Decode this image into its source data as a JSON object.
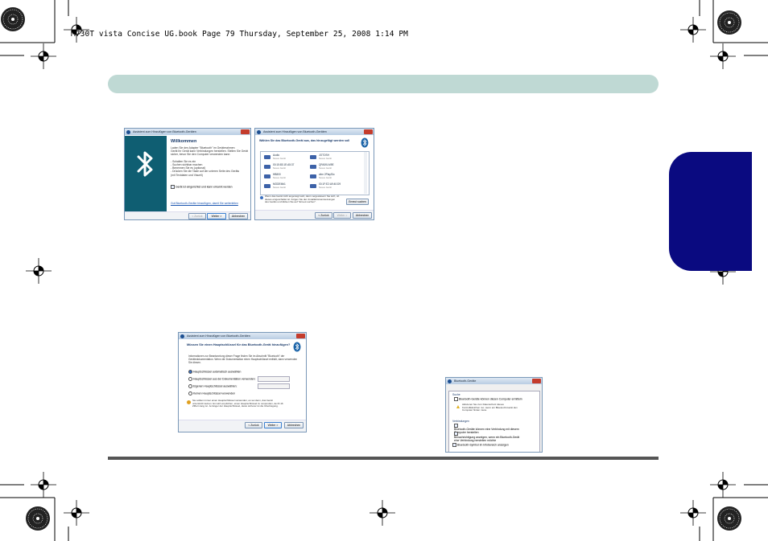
{
  "header": {
    "file_line": "M730T vista Concise UG.book  Page 79  Thursday, September 25, 2008  1:14 PM"
  },
  "dialog_welcome": {
    "title": "Assistent zum Hinzufügen von Bluetooth-Geräten",
    "heading": "Willkommen",
    "body": [
      "Laden Sie den Adapter \"Bluetooth\" im Geräterahmen",
      "Gerät Ihr Gerät kann Verbindungen herstellen. Stellen Sie Gerät",
      "sicher, bevor Sie den Computer verwenden kann:",
      "",
      "- Schalten Sie es ein",
      "- Suchen sichtbar machen",
      "- Benennen Sie es (optional)",
      "- Drücken Sie die Taste auf der unteren Seite des Geräts",
      "  (mit Textdaten und Visuell)"
    ],
    "checkbox_label": "Gerät ist eingerichtet und kann erkannt werden",
    "link": "Gut Bluetooth-Geräte hinzufügen, damit Sie weiterleiten",
    "btn_back": "< Zurück",
    "btn_next": "Weiter >",
    "btn_cancel": "Abbrechen"
  },
  "dialog_select": {
    "title": "Assistent zum Hinzufügen von Bluetooth-Geräten",
    "heading": "Wählen Sie das Bluetooth-Gerät aus, das hinzugefügt werden soll",
    "devices": [
      {
        "name": "Audio",
        "sub": "Neues Gerät"
      },
      {
        "name": "JOTOSH",
        "sub": "Neues Gerät"
      },
      {
        "name": "00:15:83:1E:A5:37",
        "sub": "Neues Gerät"
      },
      {
        "name": "QFA0KLM9E",
        "sub": "Neues Gerät"
      },
      {
        "name": "HB800",
        "sub": "Neues Gerät"
      },
      {
        "name": "citrn 2PlaySlo",
        "sub": "Neues Gerät"
      },
      {
        "name": "MODEM#1",
        "sub": "Neues Gerät"
      },
      {
        "name": "00:1F:E2:A9:40:D9",
        "sub": "Neues Gerät"
      }
    ],
    "footer_text": [
      "Wenn das Gerät nicht angezeigt wird, dann vergewissern Sie sich, ob",
      "dieses eingeschaltet ist. Folgen Sie den Installationsanweisungen",
      "des Geräts und klicken Sie auf \"Erneut suchen\"."
    ],
    "btn_search": "Erneut suchen",
    "btn_back": "< Zurück",
    "btn_next": "Weiter >",
    "btn_cancel": "Abbrechen"
  },
  "dialog_passkey": {
    "title": "Assistent zum Hinzufügen von Bluetooth-Geräten",
    "heading": "Müssen Sie einen Hauptschlüssel für das Bluetooth-Gerät hinzufügen?",
    "intro": [
      "Informationen zur Beantwortung dieser Frage finden Sie im Abschnitt \"Bluetooth\" der",
      "Gerätedokumentation. Wenn die Dokumentation einen Hauptschlüssel enthält, dann verwenden",
      "Sie diesen."
    ],
    "options": [
      "Hauptschlüssel automatisch auswählen",
      "Hauptschlüssel aus der Dokumentation verwenden:",
      "Eigenen Hauptschlüssel auswählen:",
      "Keinen Hauptschlüssel verwenden"
    ],
    "note": [
      "Sie sollten immer einen Hauptschlüssel verwenden, es sei denn, das Gerät",
      "unterstützt keinen. Es wird empfohlen, einen Hauptschlüssel zu verwenden, der 8-16",
      "Ziffern lang ist. Je länger der Hauptschlüssel, desto sicherer ist die Übertragung."
    ],
    "link_word": "Hauptschlüssel",
    "btn_back": "< Zurück",
    "btn_next": "Weiter >",
    "btn_cancel": "Abbrechen"
  },
  "dialog_settings": {
    "title": "Bluetooth-Geräte",
    "tabs": [
      "Geräte",
      "Optionen",
      "COM-Anschlüsse",
      "Hardware"
    ],
    "group_search": "Suche",
    "cb_discover": "Bluetooth-Geräte können diesen Computer ermitteln",
    "warning": [
      "Aktivieren Sie zum Datenschutz dieses",
      "Kontrollkästchen nur, wenn ein Bluetooth-Gerät den",
      "Computer finden muss."
    ],
    "group_connections": "Verbindungen",
    "cb_connect": [
      "Bluetooth-Geräte können eine Verbindung mit diesem",
      "Computer herstellen"
    ],
    "cb_notify": [
      "Benachrichtigung anzeigen, wenn ein Bluetooth-Gerät",
      "eine Verbindung herstellen möchte"
    ],
    "cb_tray": "Bluetooth-Symbol im Infobereich anzeigen"
  }
}
